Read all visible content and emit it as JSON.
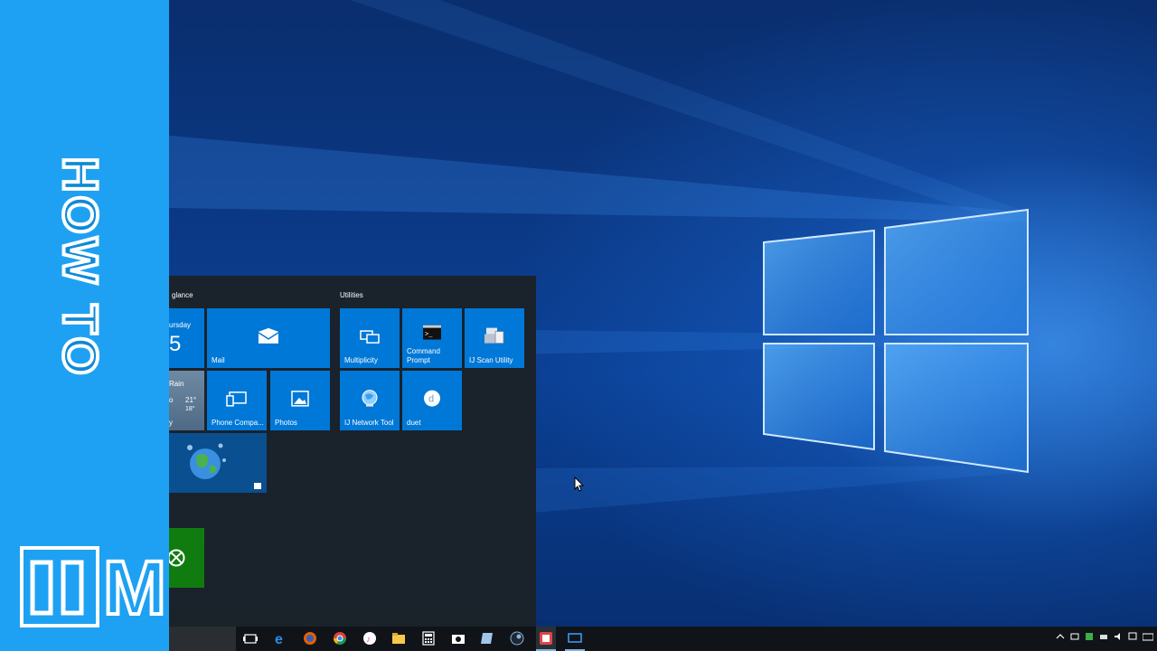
{
  "branding": {
    "title": "HOW TO",
    "logo_text": "M"
  },
  "start_menu": {
    "groups": [
      {
        "label": "glance"
      },
      {
        "label": "Utilities"
      }
    ],
    "tiles": {
      "calendar_day": "ursday",
      "calendar_date": "5",
      "mail": "Mail",
      "weather_condition": "Rain",
      "weather_high": "21°",
      "weather_low": "18°",
      "weather_left_1": "o",
      "weather_left_2": "y",
      "phone_companion": "Phone Compa...",
      "photos": "Photos",
      "multiplicity": "Multiplicity",
      "command_prompt": "Command\nPrompt",
      "ij_scan": "IJ Scan Utility",
      "ij_network": "IJ Network Tool",
      "duet": "duet"
    }
  },
  "taskbar": {
    "icons": [
      "task-view-icon",
      "edge-icon",
      "firefox-icon",
      "chrome-icon",
      "itunes-icon",
      "file-explorer-icon",
      "calculator-icon",
      "camera-icon",
      "notepad-icon",
      "steam-icon",
      "snagit-icon",
      "multiplicity-icon"
    ],
    "tray": [
      "chevron-up-icon",
      "network-icon",
      "security-icon",
      "printer-icon",
      "volume-icon",
      "action-center-icon",
      "keyboard-icon"
    ]
  },
  "colors": {
    "brand_blue": "#1ea1f2",
    "tile_blue": "#0078d7",
    "xbox_green": "#107c10",
    "start_bg": "#1b2128"
  }
}
